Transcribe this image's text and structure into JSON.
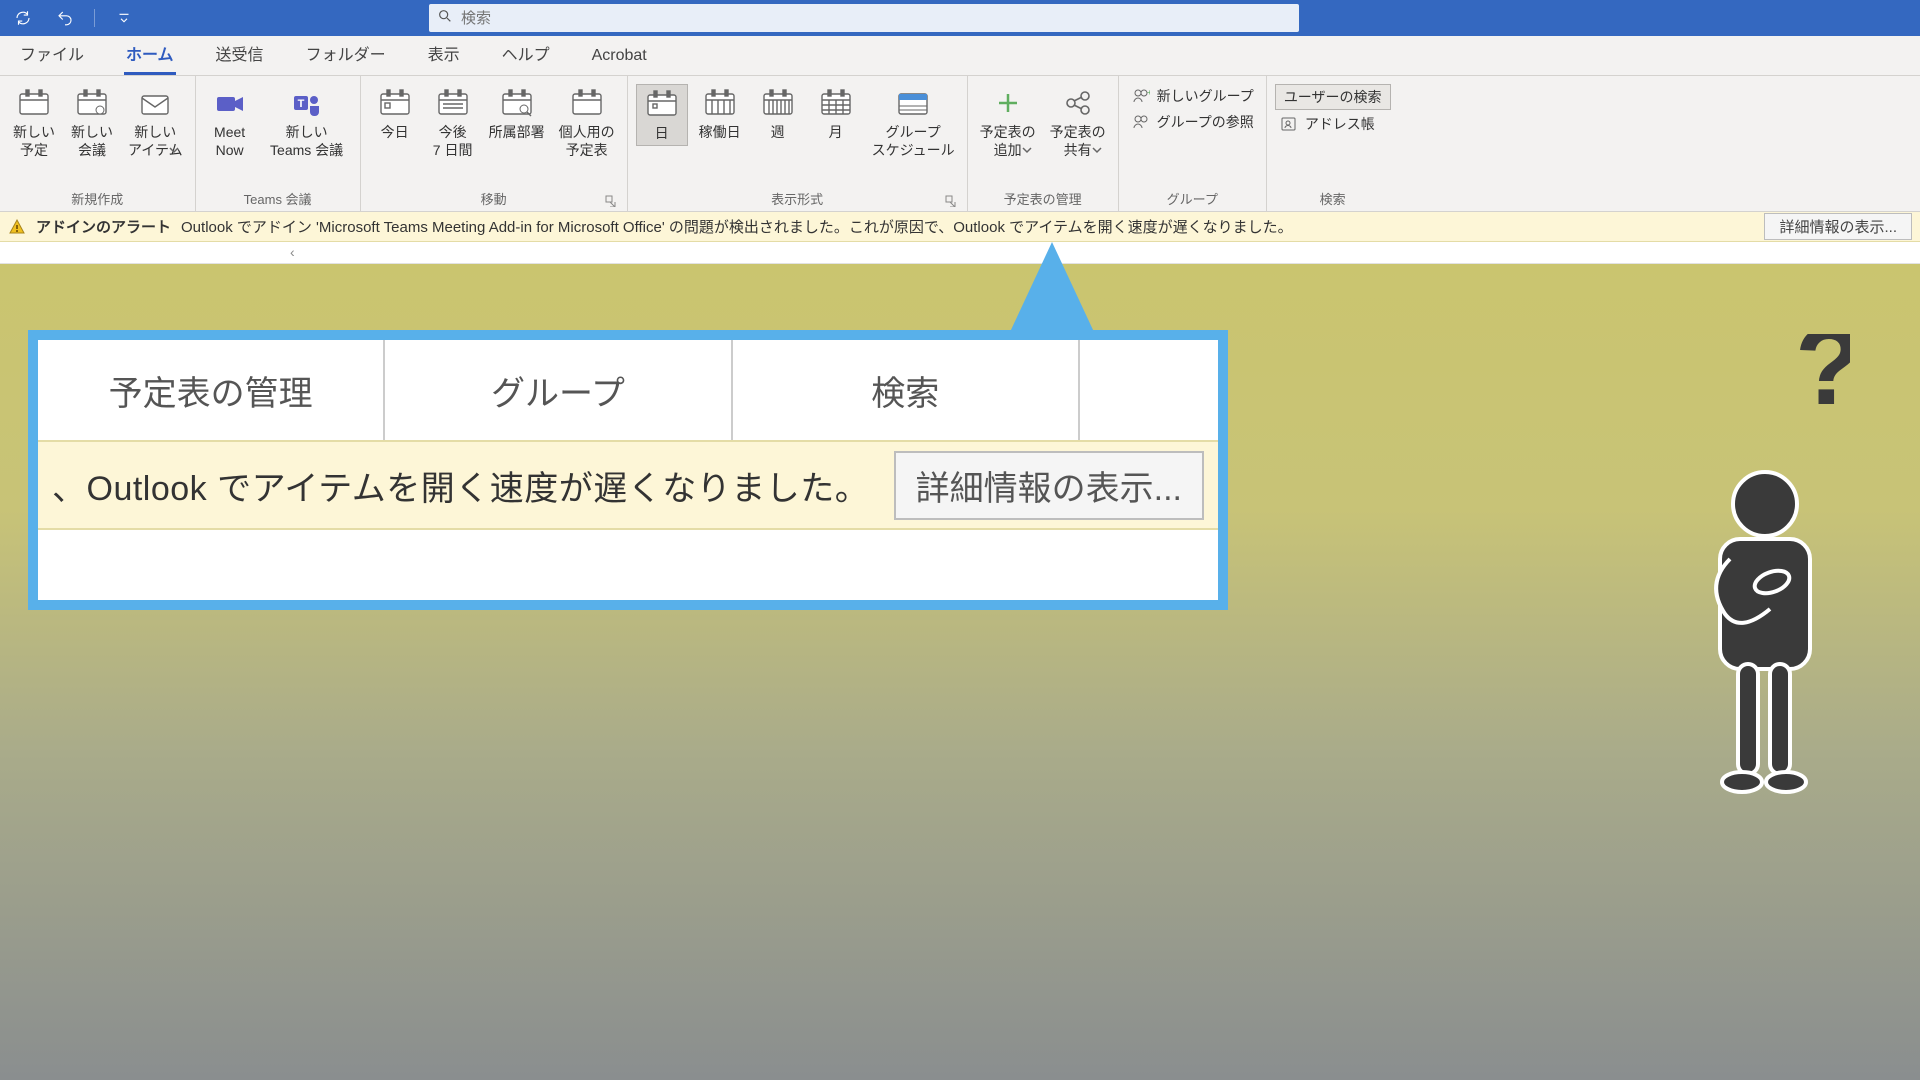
{
  "search": {
    "placeholder": "検索"
  },
  "tabs": {
    "file": "ファイル",
    "home": "ホーム",
    "sendreceive": "送受信",
    "folder": "フォルダー",
    "view": "表示",
    "help": "ヘルプ",
    "acrobat": "Acrobat"
  },
  "ribbon": {
    "new": {
      "appt": "新しい\n予定",
      "meeting": "新しい\n会議",
      "items": "新しい\nアイテム",
      "group": "新規作成"
    },
    "teams": {
      "meetnow": "Meet\nNow",
      "newmtg": "新しい\nTeams 会議",
      "group": "Teams 会議"
    },
    "goto": {
      "today": "今日",
      "next7": "今後\n7 日間",
      "dept": "所属部署",
      "personal": "個人用の\n予定表",
      "group": "移動"
    },
    "arrange": {
      "day": "日",
      "workweek": "稼働日",
      "week": "週",
      "month": "月",
      "schedule": "グループ\nスケジュール",
      "group": "表示形式"
    },
    "manage": {
      "add": "予定表の\n追加",
      "share": "予定表の\n共有",
      "group": "予定表の管理"
    },
    "groups": {
      "newg": "新しいグループ",
      "browse": "グループの参照",
      "group": "グループ"
    },
    "find": {
      "search": "ユーザーの検索",
      "addr": "アドレス帳",
      "group": "検索"
    }
  },
  "alert": {
    "title": "アドインのアラート",
    "message": "Outlook でアドイン 'Microsoft Teams Meeting Add-in for Microsoft Office' の問題が検出されました。これが原因で、Outlook でアイテムを開く速度が遅くなりました。",
    "button": "詳細情報の表示..."
  },
  "callout": {
    "h1": "予定表の管理",
    "h2": "グループ",
    "h3": "検索",
    "line": "、Outlook でアイテムを開く速度が遅くなりました。",
    "button": "詳細情報の表示..."
  }
}
